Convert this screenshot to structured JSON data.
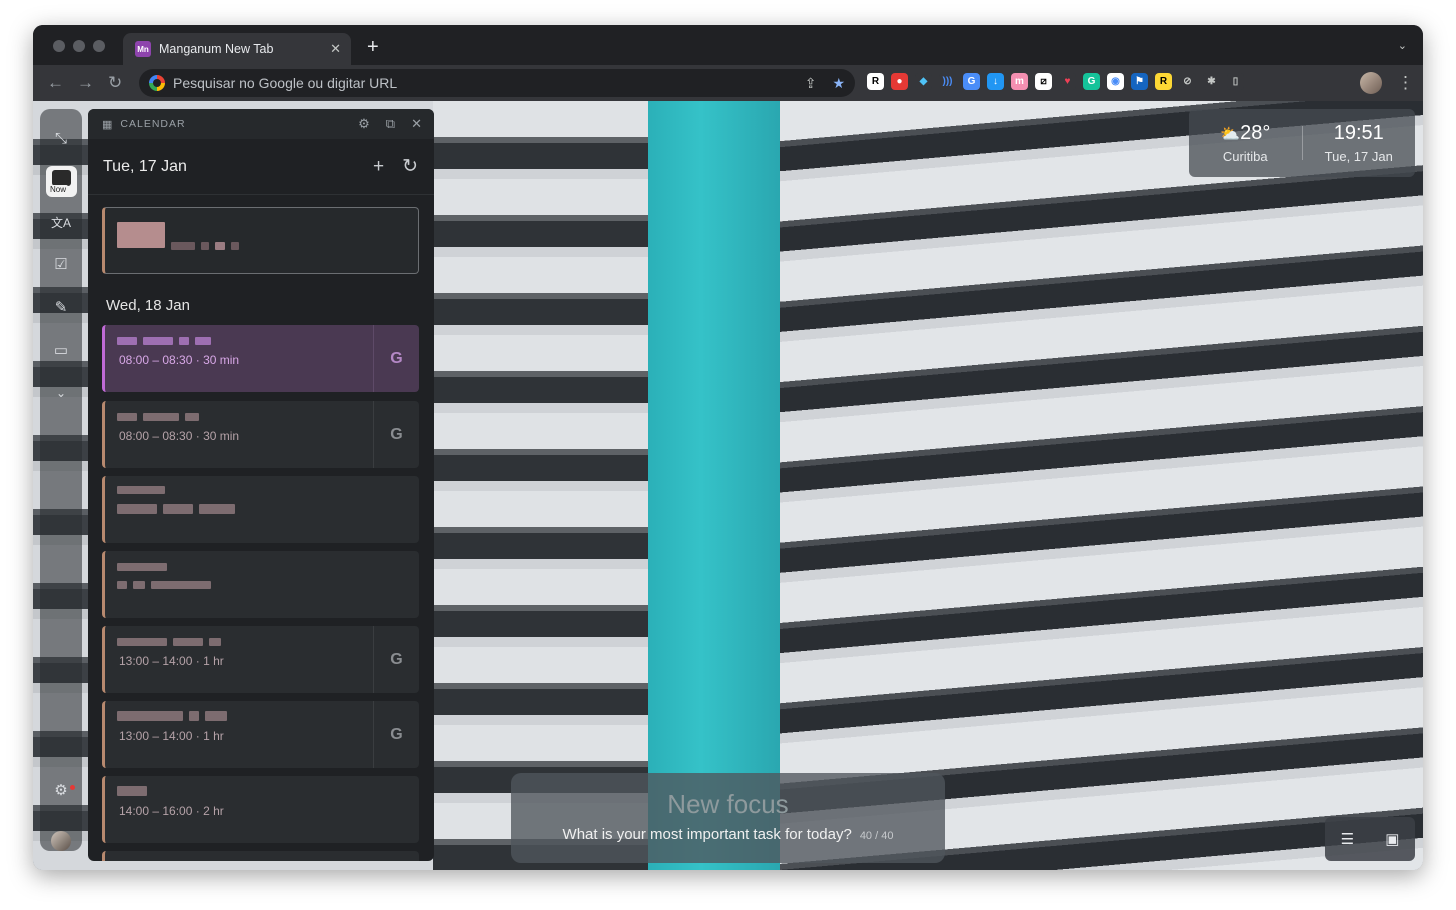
{
  "browser": {
    "tab_title": "Manganum New Tab",
    "tab_favicon": "Mn",
    "tab_close": "✕",
    "new_tab": "+",
    "tabs_menu": "⌄",
    "omnibox_placeholder": "Pesquisar no Google ou digitar URL",
    "nav": {
      "back": "←",
      "forward": "→",
      "reload": "↻"
    },
    "omni_icons": {
      "share": "⇪",
      "bookmark": "★"
    },
    "extensions": [
      {
        "name": "readwise-icon",
        "glyph": "R",
        "color": "#ffffff",
        "fg": "#000000"
      },
      {
        "name": "pokeball-icon",
        "glyph": "●",
        "color": "#e53935",
        "fg": "#ffffff"
      },
      {
        "name": "diamond-icon",
        "glyph": "◆",
        "color": "#35363a",
        "fg": "#4fc3f7"
      },
      {
        "name": "voice-icon",
        "glyph": ")))",
        "color": "#35363a",
        "fg": "#4a8df8"
      },
      {
        "name": "translate-icon",
        "glyph": "G",
        "color": "#4a8df8",
        "fg": "#ffffff"
      },
      {
        "name": "download-icon",
        "glyph": "↓",
        "color": "#2196f3",
        "fg": "#ffffff"
      },
      {
        "name": "m-icon",
        "glyph": "m",
        "color": "#f48fb1",
        "fg": "#ffffff"
      },
      {
        "name": "notion-icon",
        "glyph": "⧄",
        "color": "#ffffff",
        "fg": "#000000"
      },
      {
        "name": "pocket-icon",
        "glyph": "♥",
        "color": "#35363a",
        "fg": "#ef4056"
      },
      {
        "name": "grammarly-icon",
        "glyph": "G",
        "color": "#15c39a",
        "fg": "#ffffff"
      },
      {
        "name": "lens-icon",
        "glyph": "◉",
        "color": "#ffffff",
        "fg": "#4a8df8"
      },
      {
        "name": "flag-icon",
        "glyph": "⚑",
        "color": "#1565c0",
        "fg": "#ffffff"
      },
      {
        "name": "r-yellow-icon",
        "glyph": "R",
        "color": "#fdd835",
        "fg": "#000000"
      },
      {
        "name": "blocked-icon",
        "glyph": "⊘",
        "color": "#35363a",
        "fg": "#c4c7c5"
      },
      {
        "name": "puzzle-icon",
        "glyph": "✱",
        "color": "#35363a",
        "fg": "#c4c7c5"
      },
      {
        "name": "sidepanel-icon",
        "glyph": "▯",
        "color": "#35363a",
        "fg": "#c4c7c5"
      }
    ],
    "more_menu": "⋮"
  },
  "rail": {
    "now_label": "Now",
    "icons": [
      "⤡",
      "文A",
      "☑",
      "✎",
      "▭",
      "⌄",
      "⚙"
    ]
  },
  "calendar": {
    "header_title": "CALENDAR",
    "header_icons": {
      "calendar": "▦",
      "settings": "⚙",
      "open": "⧉",
      "close": "✕"
    },
    "day1_title": "Tue, 17 Jan",
    "day_add": "+",
    "day_refresh": "↻",
    "day2_title": "Wed, 18 Jan",
    "events": [
      {
        "time": "08:00 – 08:30  ·  30 min",
        "g": "G"
      },
      {
        "time": "08:00 – 08:30  ·  30 min",
        "g": "G"
      },
      {
        "time": "13:00 – 14:00  ·  1 hr",
        "g": "G"
      },
      {
        "time": "13:00 – 14:00  ·  1 hr",
        "g": "G"
      },
      {
        "time": "14:00 – 16:00  ·  2 hr"
      }
    ]
  },
  "weather": {
    "temp": "28°",
    "city": "Curitiba",
    "icon": "⛅",
    "time": "19:51",
    "date": "Tue, 17 Jan"
  },
  "focus": {
    "title": "New focus",
    "question": "What is your most important task for today?",
    "count": "40 / 40"
  },
  "bottom_tools": {
    "layout": "☰",
    "image": "▣"
  }
}
